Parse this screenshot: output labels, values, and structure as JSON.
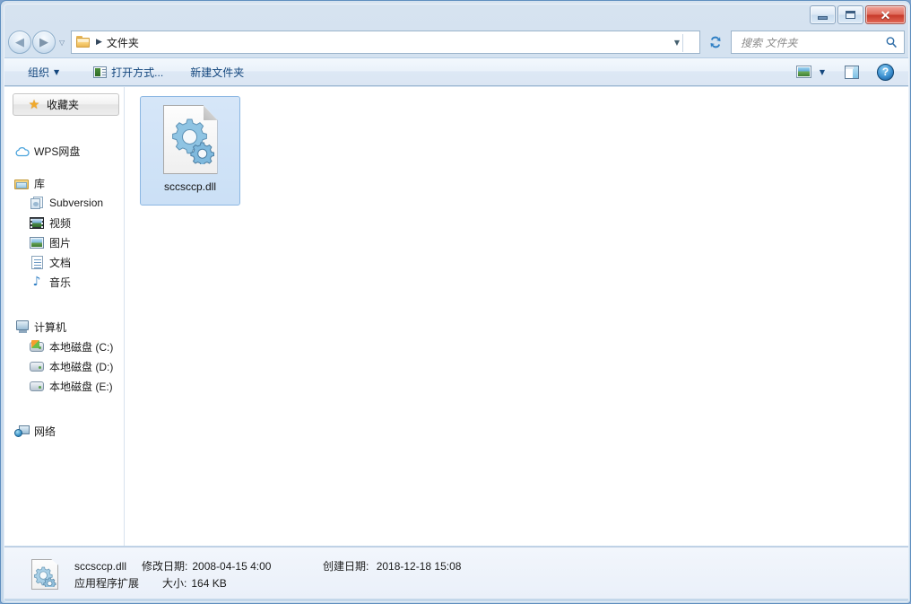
{
  "window": {
    "controls": {
      "minimize_label": "–",
      "maximize_label": "□",
      "close_label": "✕"
    }
  },
  "navbar": {
    "back_glyph": "◀",
    "forward_glyph": "▶",
    "recent_caret": "▽",
    "breadcrumb_separator": "▶",
    "breadcrumb_text": "文件夹",
    "address_caret": "▼",
    "refresh_icon": "refresh-icon",
    "search_placeholder": "搜索 文件夹",
    "search_icon": "search-icon"
  },
  "toolbar": {
    "organize_label": "组织",
    "organize_caret": "▼",
    "open_with_label": "打开方式...",
    "new_folder_label": "新建文件夹",
    "view_caret": "▼"
  },
  "sidebar": {
    "favorites": {
      "label": "收藏夹",
      "icon": "star-icon"
    },
    "groups": [
      {
        "icon": "cloud-icon",
        "label": "WPS网盘",
        "children": []
      },
      {
        "icon": "library-icon",
        "label": "库",
        "children": [
          {
            "icon": "subversion-icon",
            "label": "Subversion"
          },
          {
            "icon": "video-icon",
            "label": "视频"
          },
          {
            "icon": "picture-icon",
            "label": "图片"
          },
          {
            "icon": "document-icon",
            "label": "文档"
          },
          {
            "icon": "music-icon",
            "label": "音乐"
          }
        ]
      },
      {
        "icon": "computer-icon",
        "label": "计算机",
        "children": [
          {
            "icon": "system-drive-icon",
            "label": "本地磁盘 (C:)"
          },
          {
            "icon": "drive-icon",
            "label": "本地磁盘 (D:)"
          },
          {
            "icon": "drive-icon",
            "label": "本地磁盘 (E:)"
          }
        ]
      },
      {
        "icon": "network-icon",
        "label": "网络",
        "children": []
      }
    ]
  },
  "content": {
    "files": [
      {
        "name": "sccsccp.dll",
        "icon": "dll-gears-icon",
        "selected": true
      }
    ]
  },
  "statusbar": {
    "file_name": "sccsccp.dll",
    "modified_label": "修改日期:",
    "modified_value": "2008-04-15 4:00",
    "created_label": "创建日期:",
    "created_value": "2018-12-18 15:08",
    "file_type": "应用程序扩展",
    "size_label": "大小:",
    "size_value": "164 KB"
  },
  "colors": {
    "selection_fill": "#cfe0f5",
    "selection_border": "#8cb7e2",
    "toolbar_text": "#14477e",
    "close_button": "#c6392a",
    "accent_blue": "#3a6ea5"
  }
}
